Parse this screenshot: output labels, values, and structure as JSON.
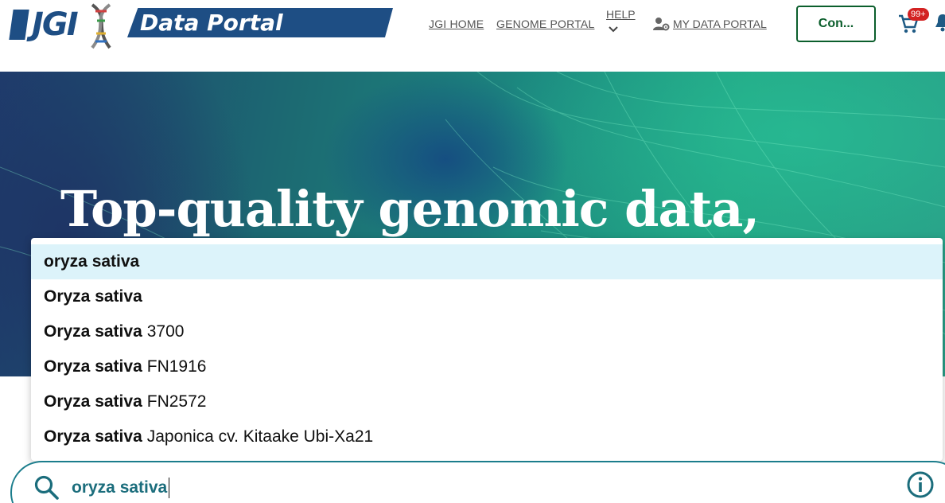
{
  "header": {
    "logo_text": "JGI",
    "portal_title": "Data Portal",
    "nav": {
      "jgi_home": "JGI HOME",
      "genome_portal": "GENOME PORTAL",
      "help": "HELP",
      "my_data_portal": "MY DATA PORTAL"
    },
    "contact_button": "Con...",
    "cart_badge": "99+"
  },
  "hero": {
    "title": "Top-quality genomic data,"
  },
  "autocomplete": {
    "items": [
      {
        "match": "oryza sativa",
        "rest": ""
      },
      {
        "match": "Oryza sativa",
        "rest": ""
      },
      {
        "match": "Oryza sativa",
        "rest": "3700"
      },
      {
        "match": "Oryza sativa",
        "rest": "FN1916"
      },
      {
        "match": "Oryza sativa",
        "rest": "FN2572"
      },
      {
        "match": "Oryza sativa",
        "rest": "Japonica cv. Kitaake Ubi-Xa21"
      }
    ]
  },
  "search": {
    "value": "oryza sativa"
  },
  "colors": {
    "brand_blue": "#1e4e84",
    "button_green": "#0b5e2c",
    "search_teal": "#1b7d8c",
    "highlight": "#dcf3fa",
    "badge_red": "#d32222"
  }
}
